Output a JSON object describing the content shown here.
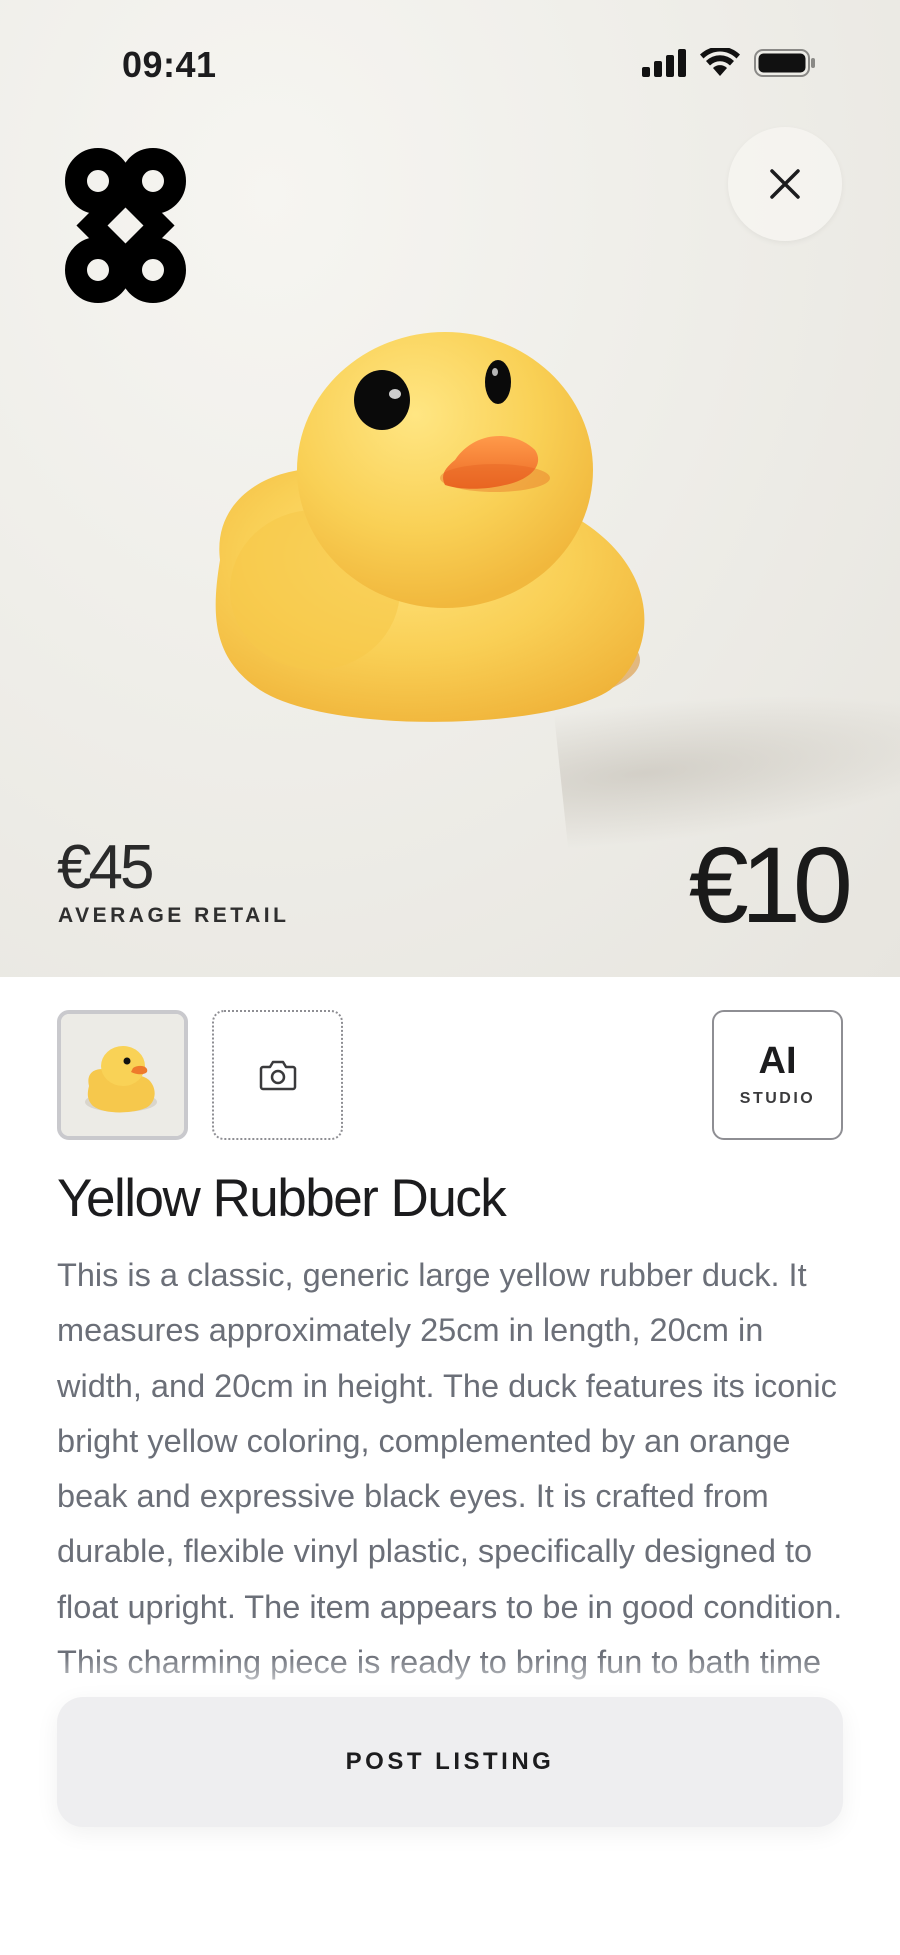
{
  "status_bar": {
    "time": "09:41"
  },
  "hero": {
    "average_retail_price": "€45",
    "average_retail_label": "AVERAGE RETAIL",
    "listing_price": "€10",
    "product_image": "yellow-rubber-duck-photo"
  },
  "media": {
    "thumbnail": "yellow-rubber-duck-thumbnail",
    "add_photo_icon": "camera-icon",
    "ai_studio": {
      "title": "AI",
      "subtitle": "STUDIO"
    }
  },
  "product": {
    "title": "Yellow Rubber Duck",
    "description": "This is a classic, generic large yellow rubber duck. It measures approximately 25cm in length, 20cm in width, and 20cm in height. The duck features its iconic bright yellow coloring, complemented by an orange beak and expressive black eyes. It is crafted from durable, flexible vinyl plastic, specifically designed to float upright. The item appears to be in good condition. This charming piece is ready to bring fun to bath time or serve as a nostalgic decorative item."
  },
  "actions": {
    "post_listing": "POST LISTING"
  },
  "colors": {
    "duck_yellow": "#f7c948",
    "beak_orange": "#f07a2e",
    "text_gray": "#6b6f78"
  }
}
